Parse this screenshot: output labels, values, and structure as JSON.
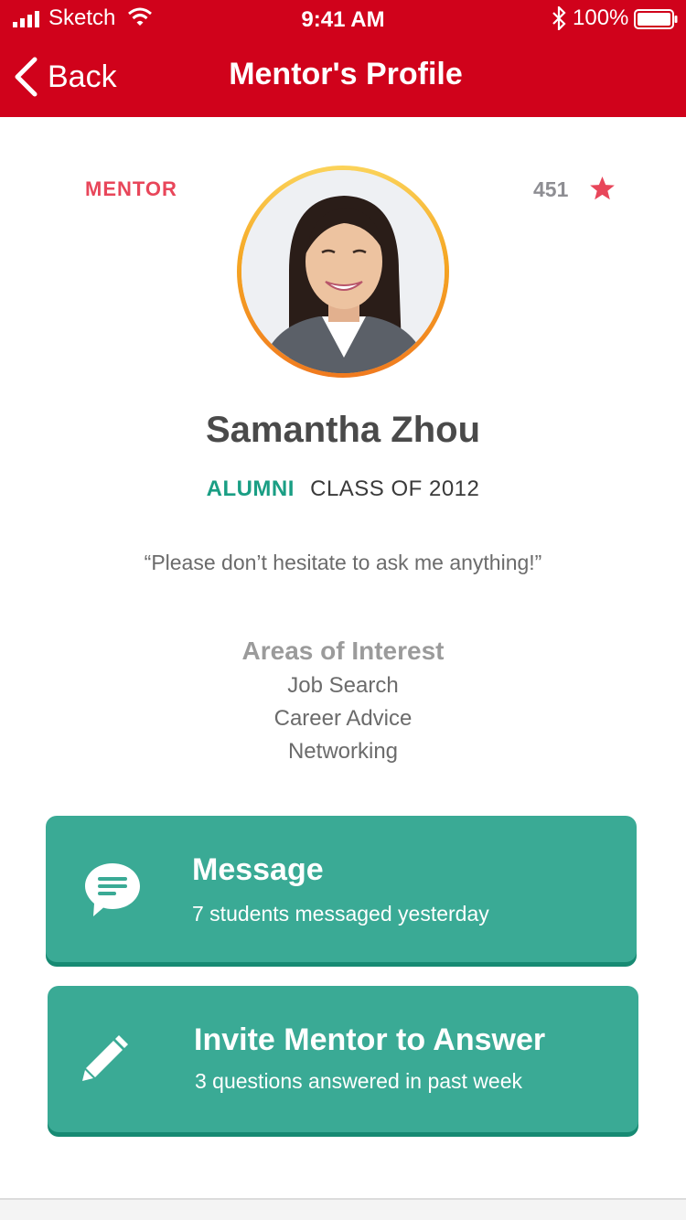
{
  "status_bar": {
    "carrier": "Sketch",
    "time": "9:41 AM",
    "battery": "100%"
  },
  "nav": {
    "back_label": "Back",
    "title": "Mentor's Profile"
  },
  "profile": {
    "role": "MENTOR",
    "rating_count": "451",
    "name": "Samantha Zhou",
    "status": "ALUMNI",
    "class_year": "CLASS OF 2012",
    "quote": "“Please don’t hesitate to ask me anything!”"
  },
  "interests": {
    "heading": "Areas of Interest",
    "items": [
      "Job Search",
      "Career Advice",
      "Networking"
    ]
  },
  "actions": {
    "message": {
      "title": "Message",
      "subtitle": "7 students messaged yesterday",
      "icon": "chat-bubble-icon"
    },
    "invite": {
      "title": "Invite Mentor to Answer",
      "subtitle": "3 questions answered in past week",
      "icon": "pencil-icon"
    }
  },
  "colors": {
    "header": "#d0021b",
    "accent_red": "#e8465a",
    "teal": "#3aaa95",
    "teal_dark": "#178a73",
    "alumni_green": "#1a9e84"
  }
}
